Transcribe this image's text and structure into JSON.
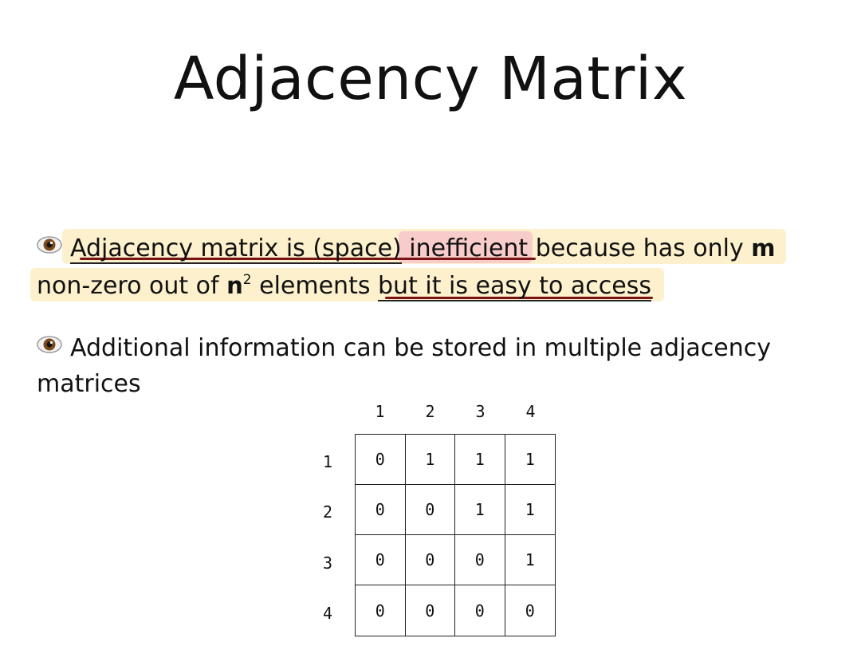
{
  "slide": {
    "title": "Adjacency Matrix"
  },
  "bullets": [
    {
      "icon": "eye-icon",
      "line1": {
        "u_part": "Adjacency matrix is (space)",
        "pink_part": " inefficient ",
        "rest": "because has only ",
        "m": "m"
      },
      "line2": {
        "pre": "non-zero out of ",
        "n": "n",
        "sup": "2",
        "mid": " elements ",
        "u_part": "but it is easy to access"
      }
    },
    {
      "icon": "eye-icon",
      "line1": "Additional information can be stored in multiple adjacency",
      "line2": "matrices"
    }
  ],
  "matrix": {
    "col_labels": [
      "1",
      "2",
      "3",
      "4"
    ],
    "row_labels": [
      "1",
      "2",
      "3",
      "4"
    ],
    "rows": [
      [
        "0",
        "1",
        "1",
        "1"
      ],
      [
        "0",
        "0",
        "1",
        "1"
      ],
      [
        "0",
        "0",
        "0",
        "1"
      ],
      [
        "0",
        "0",
        "0",
        "0"
      ]
    ]
  },
  "colors": {
    "highlight_yellow": "#fdf0cc",
    "highlight_pink": "#f9cccc",
    "annotation_red": "#7a1414"
  }
}
